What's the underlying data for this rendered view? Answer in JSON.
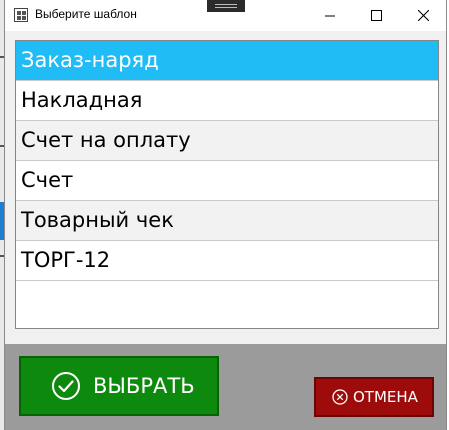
{
  "window": {
    "title": "Выберите шаблон"
  },
  "templates": [
    {
      "label": "Заказ-наряд",
      "selected": true
    },
    {
      "label": "Накладная",
      "selected": false
    },
    {
      "label": "Счет на оплату",
      "selected": false
    },
    {
      "label": "Счет",
      "selected": false
    },
    {
      "label": "Товарный чек",
      "selected": false
    },
    {
      "label": "ТОРГ-12",
      "selected": false
    }
  ],
  "footer": {
    "select_label": "ВЫБРАТЬ",
    "cancel_label": "ОТМЕНА"
  },
  "icons": {
    "select": "check-circle-icon",
    "cancel": "x-circle-icon"
  },
  "colors": {
    "selection": "#1fbcf6",
    "select_button": "#0d8a0d",
    "cancel_button": "#9e0b0b",
    "footer": "#9b9b9b"
  }
}
